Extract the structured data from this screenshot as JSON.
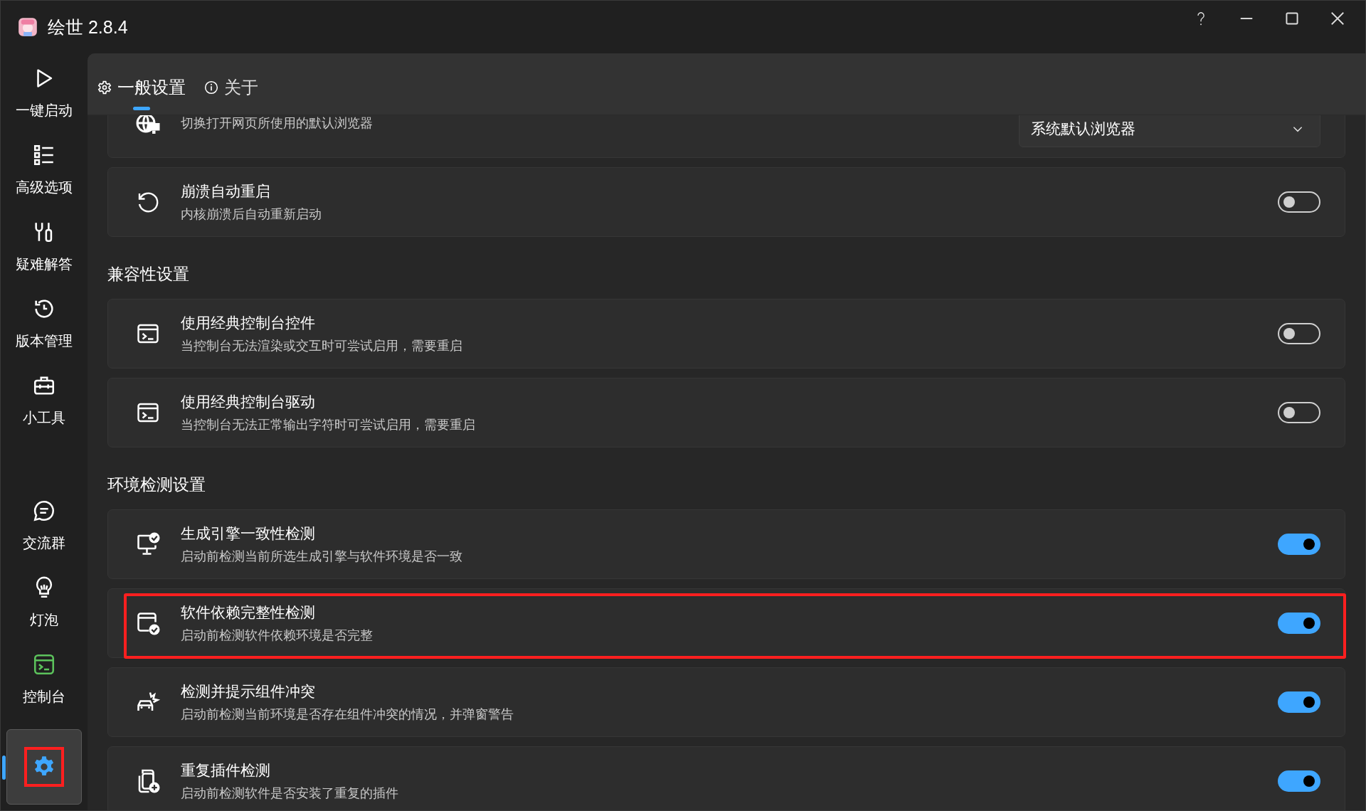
{
  "window": {
    "title": "绘世 2.8.4"
  },
  "sidebar": {
    "top_items": [
      {
        "label": "一键启动",
        "selected": false,
        "color": "#ffffff"
      },
      {
        "label": "高级选项",
        "selected": false,
        "color": "#ffffff"
      },
      {
        "label": "疑难解答",
        "selected": false,
        "color": "#ffffff"
      },
      {
        "label": "版本管理",
        "selected": false,
        "color": "#ffffff"
      },
      {
        "label": "小工具",
        "selected": false,
        "color": "#ffffff"
      }
    ],
    "bottom_items": [
      {
        "label": "交流群",
        "selected": false,
        "color": "#ffffff"
      },
      {
        "label": "灯泡",
        "selected": false,
        "color": "#ffffff"
      },
      {
        "label": "控制台",
        "selected": false,
        "color": "#5cc35c"
      }
    ],
    "settings_item": {
      "selected": true,
      "highlighted": true
    }
  },
  "tabs": [
    {
      "label": "一般设置",
      "selected": true
    },
    {
      "label": "关于",
      "selected": false
    }
  ],
  "sections": [
    {
      "rows": [
        {
          "kind": "dropdown",
          "description": "切换打开网页所使用的默认浏览器",
          "value": "系统默认浏览器",
          "highlighted": false
        },
        {
          "kind": "toggle",
          "title": "崩溃自动重启",
          "description": "内核崩溃后自动重新启动",
          "on": false,
          "highlighted": false
        }
      ]
    },
    {
      "heading": "兼容性设置",
      "rows": [
        {
          "kind": "toggle",
          "title": "使用经典控制台控件",
          "description": "当控制台无法渲染或交互时可尝试启用，需要重启",
          "on": false,
          "highlighted": false
        },
        {
          "kind": "toggle",
          "title": "使用经典控制台驱动",
          "description": "当控制台无法正常输出字符时可尝试启用，需要重启",
          "on": false,
          "highlighted": false
        }
      ]
    },
    {
      "heading": "环境检测设置",
      "rows": [
        {
          "kind": "toggle",
          "title": "生成引擎一致性检测",
          "description": "启动前检测当前所选生成引擎与软件环境是否一致",
          "on": true,
          "highlighted": false
        },
        {
          "kind": "toggle",
          "title": "软件依赖完整性检测",
          "description": "启动前检测软件依赖环境是否完整",
          "on": true,
          "highlighted": true
        },
        {
          "kind": "toggle",
          "title": "检测并提示组件冲突",
          "description": "启动前检测当前环境是否存在组件冲突的情况，并弹窗警告",
          "on": true,
          "highlighted": false
        },
        {
          "kind": "toggle",
          "title": "重复插件检测",
          "description": "启动前检测软件是否安装了重复的插件",
          "on": true,
          "highlighted": false
        }
      ]
    }
  ]
}
